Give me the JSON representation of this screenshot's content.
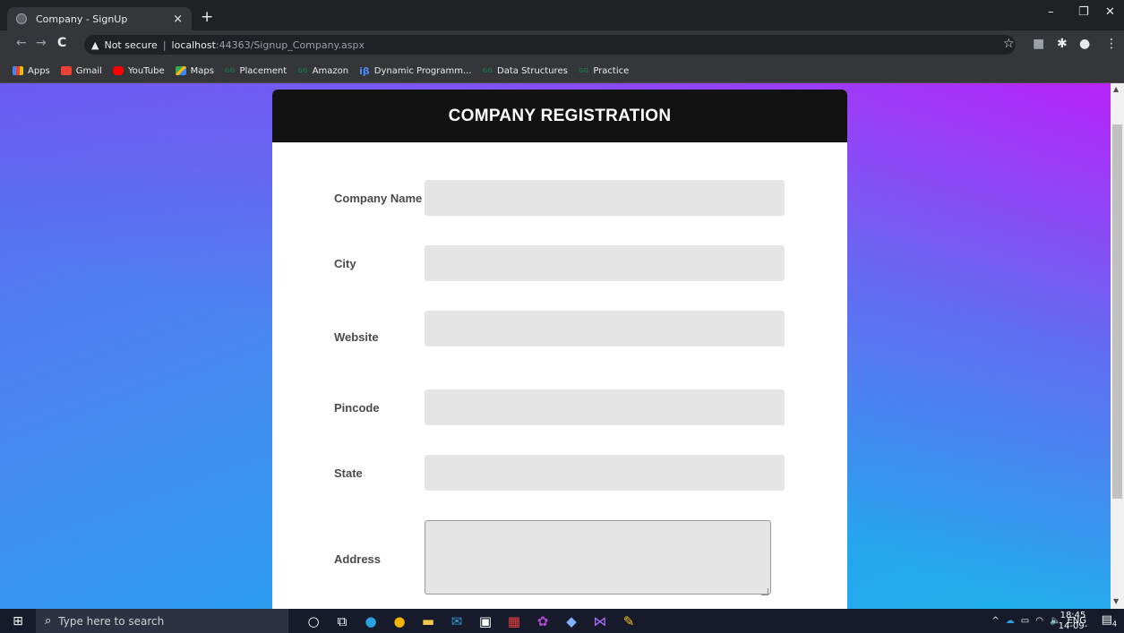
{
  "browser": {
    "tab_title": "Company - SignUp",
    "tab_close": "×",
    "new_tab": "+",
    "window_controls": {
      "minimize": "–",
      "restore": "❐",
      "close": "✕"
    },
    "nav": {
      "back": "←",
      "forward": "→",
      "reload": "C"
    },
    "address": {
      "warning_icon": "▲",
      "not_secure": "Not secure",
      "separator": "|",
      "host": "localhost",
      "path": ":44363/Signup_Company.aspx"
    },
    "toolbar_icons": {
      "star": "☆",
      "extension": "■",
      "puzzle": "✱",
      "profile": "●",
      "menu": "⋮"
    },
    "bookmarks": [
      {
        "label": "Apps",
        "icon": "apps-icon",
        "color": "#e54c3c"
      },
      {
        "label": "Gmail",
        "icon": "gmail-icon",
        "color": "#ea4335"
      },
      {
        "label": "YouTube",
        "icon": "youtube-icon",
        "color": "#ff0000"
      },
      {
        "label": "Maps",
        "icon": "maps-icon",
        "color": "#34a853"
      },
      {
        "label": "Placement",
        "icon": "gfg-icon",
        "color": "#2f8d46"
      },
      {
        "label": "Amazon",
        "icon": "gfg-icon",
        "color": "#2f8d46"
      },
      {
        "label": "Dynamic Programm...",
        "icon": "ib-icon",
        "color": "#4c8bf5"
      },
      {
        "label": "Data Structures",
        "icon": "gfg-icon",
        "color": "#2f8d46"
      },
      {
        "label": "Practice",
        "icon": "gfg-icon",
        "color": "#2f8d46"
      }
    ]
  },
  "form": {
    "title": "COMPANY REGISTRATION",
    "fields": [
      {
        "label": "Company Name",
        "value": "",
        "type": "text"
      },
      {
        "label": "City",
        "value": "",
        "type": "text"
      },
      {
        "label": "Website",
        "value": "",
        "type": "text"
      },
      {
        "label": "Pincode",
        "value": "",
        "type": "text"
      },
      {
        "label": "State",
        "value": "",
        "type": "text"
      },
      {
        "label": "Address",
        "value": "",
        "type": "textarea"
      }
    ]
  },
  "taskbar": {
    "start_icon": "⊞",
    "search_placeholder": "Type here to search",
    "search_icon": "⌕",
    "apps": [
      {
        "name": "cortana-icon",
        "glyph": "○",
        "color": "#ffffff"
      },
      {
        "name": "task-view-icon",
        "glyph": "⧉",
        "color": "#ffffff"
      },
      {
        "name": "edge-icon",
        "glyph": "●",
        "color": "#2aa1e0"
      },
      {
        "name": "chrome-icon",
        "glyph": "●",
        "color": "#f4b400"
      },
      {
        "name": "file-explorer-icon",
        "glyph": "▬",
        "color": "#f2c94c"
      },
      {
        "name": "mail-icon",
        "glyph": "✉",
        "color": "#2d9cdb"
      },
      {
        "name": "store-icon",
        "glyph": "▣",
        "color": "#ffffff"
      },
      {
        "name": "gift-icon",
        "glyph": "▦",
        "color": "#e04040"
      },
      {
        "name": "teams-icon",
        "glyph": "✿",
        "color": "#b04bd0"
      },
      {
        "name": "notes-icon",
        "glyph": "◆",
        "color": "#7fb3ff"
      },
      {
        "name": "visual-studio-icon",
        "glyph": "⋈",
        "color": "#a970ff"
      },
      {
        "name": "paint-icon",
        "glyph": "✎",
        "color": "#f5c518"
      }
    ],
    "tray": {
      "chevron": "^",
      "cloud": "☁",
      "battery": "▭",
      "wifi": "◠",
      "volume": "🔈",
      "lang": "ENG"
    },
    "clock": {
      "time": "18:45",
      "date": "14-09-2020"
    },
    "notifications_icon": "▤",
    "notifications_count": "4"
  }
}
